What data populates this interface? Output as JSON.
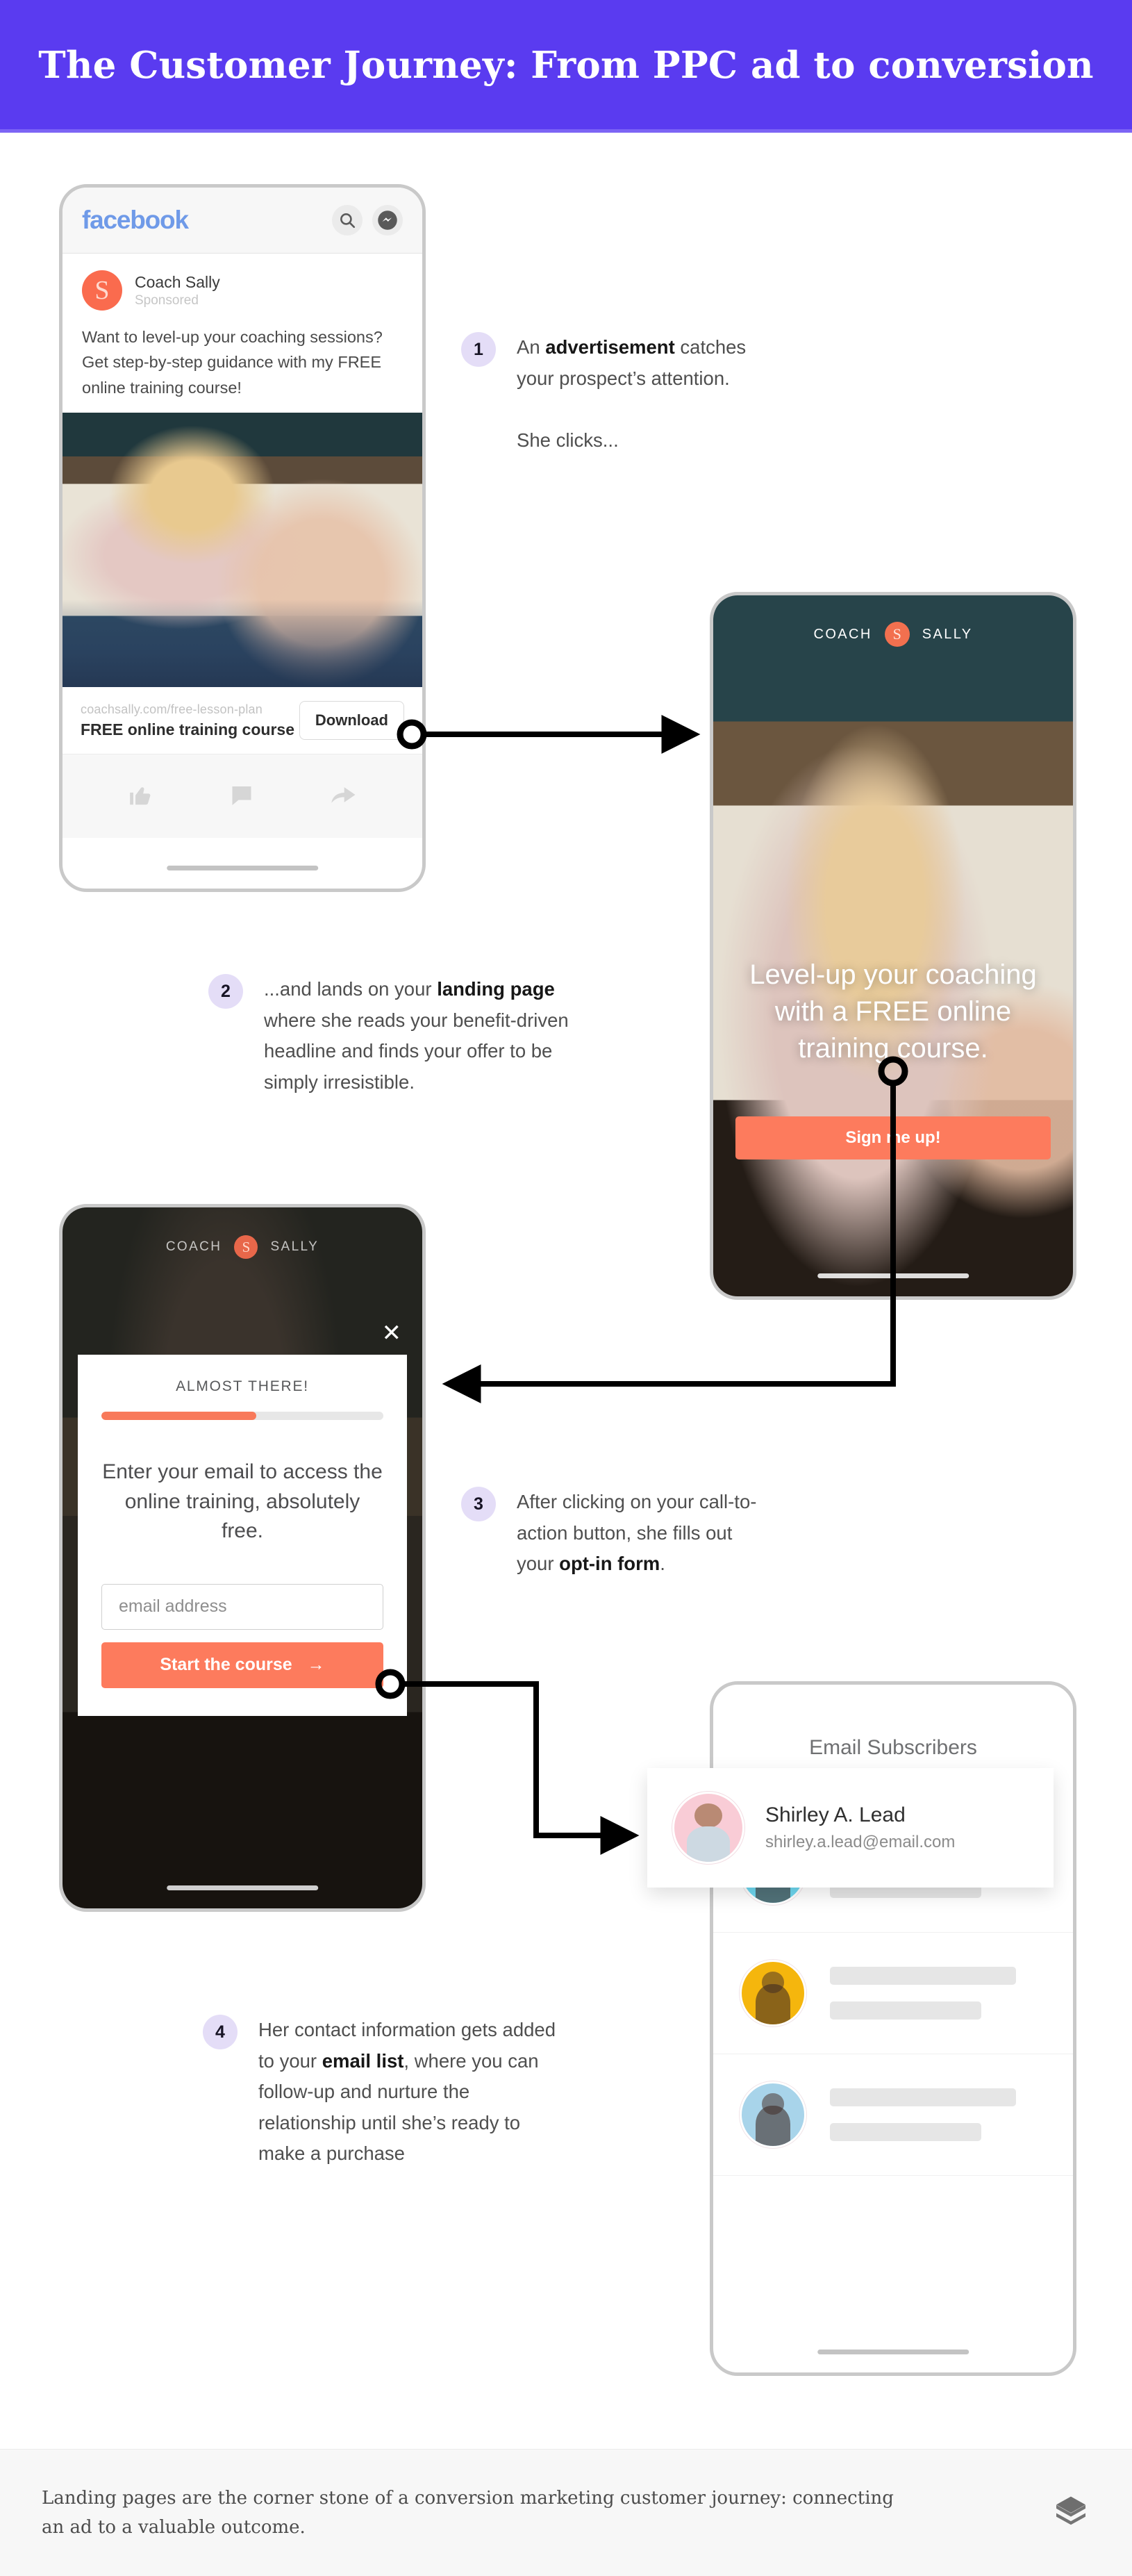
{
  "header": {
    "title": "The Customer Journey: From PPC ad to conversion",
    "bg_color": "#5A3BF0"
  },
  "facebook_ad": {
    "logo": "facebook",
    "search_icon": "search-icon",
    "messenger_icon": "messenger-icon",
    "page_avatar_letter": "S",
    "page_name": "Coach Sally",
    "sponsored_label": "Sponsored",
    "body_text": "Want to level-up your coaching sessions? Get step-by-step guidance with my FREE online training course!",
    "link_url": "coachsally.com/free-lesson-plan",
    "link_title": "FREE online training course",
    "cta_label": "Download",
    "actions": [
      "like-icon",
      "comment-icon",
      "share-icon"
    ]
  },
  "landing_page": {
    "logo_left": "COACH",
    "logo_badge": "S",
    "logo_right": "SALLY",
    "headline": "Level-up your coaching with a FREE online training course.",
    "cta_label": "Sign me up!",
    "cta_color": "#fd7b5d"
  },
  "optin_modal": {
    "logo_left": "COACH",
    "logo_badge": "S",
    "logo_right": "SALLY",
    "close_icon": "close-icon",
    "kicker": "ALMOST THERE!",
    "progress_percent": 55,
    "lead": "Enter your email to access the online training, absolutely free.",
    "email_placeholder": "email address",
    "email_value": "",
    "submit_label": "Start the course",
    "submit_arrow": "arrow-right-icon",
    "submit_color": "#fd7b5d"
  },
  "subscribers": {
    "title": "Email Subscribers",
    "highlight": {
      "name": "Shirley A. Lead",
      "email": "shirley.a.lead@email.com"
    },
    "rows": [
      {
        "avatar_color": "#6ed8f0"
      },
      {
        "avatar_color": "#f5b60d"
      },
      {
        "avatar_color": "#a8d4ea"
      }
    ]
  },
  "steps": [
    {
      "number": "1",
      "line1_pre": "An ",
      "line1_bold": "advertisement",
      "line1_post": " catches your prospect’s attention.",
      "line2": "She clicks..."
    },
    {
      "number": "2",
      "pre": "...and lands on your ",
      "bold": "landing page",
      "post": " where she reads your benefit-driven headline and finds your offer to be simply irresistible."
    },
    {
      "number": "3",
      "pre": "After clicking on your call-to-action button, she fills out your ",
      "bold": "opt-in form",
      "post": "."
    },
    {
      "number": "4",
      "pre": "Her contact information gets added to your ",
      "bold": "email list",
      "post": ", where you can follow-up and nurture the relationship until she’s ready to make a purchase"
    }
  ],
  "footer": {
    "text": "Landing pages are the corner stone of a conversion marketing customer journey: connecting an ad to a valuable outcome.",
    "icon": "layers-icon"
  }
}
